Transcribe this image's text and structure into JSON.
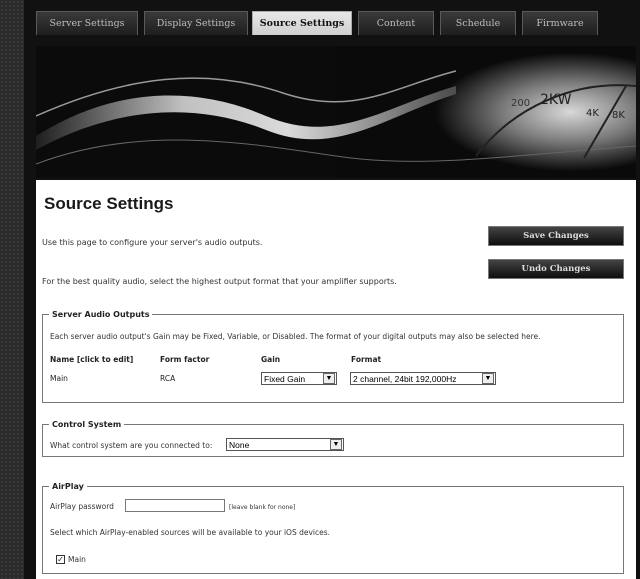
{
  "tabs": [
    {
      "label": "Server Settings",
      "active": false
    },
    {
      "label": "Display Settings",
      "active": false
    },
    {
      "label": "Source Settings",
      "active": true
    },
    {
      "label": "Content",
      "active": false
    },
    {
      "label": "Schedule",
      "active": false
    },
    {
      "label": "Firmware",
      "active": false
    }
  ],
  "banner": {
    "meter_labels": [
      "200",
      "2KW",
      "4K",
      "8K"
    ]
  },
  "page": {
    "title": "Source Settings",
    "intro_1": "Use this page to configure your server's audio outputs.",
    "intro_2": "For the best quality audio, select the highest output format that your amplifier supports."
  },
  "buttons": {
    "save": "Save Changes",
    "undo": "Undo Changes"
  },
  "audio_outputs": {
    "legend": "Server Audio Outputs",
    "description": "Each server audio output's Gain may be Fixed, Variable, or Disabled. The format of your digital outputs may also be selected here.",
    "headers": {
      "name": "Name [click to edit]",
      "form_factor": "Form factor",
      "gain": "Gain",
      "format": "Format"
    },
    "rows": [
      {
        "name": "Main",
        "form_factor": "RCA",
        "gain": "Fixed Gain",
        "format": "2 channel, 24bit 192,000Hz"
      }
    ]
  },
  "control_system": {
    "legend": "Control System",
    "question": "What control system are you connected to:",
    "selected": "None"
  },
  "airplay": {
    "legend": "AirPlay",
    "password_label": "AirPlay password",
    "password_value": "",
    "password_hint": "[leave blank for none]",
    "sources_prompt": "Select which AirPlay-enabled sources will be available to your iOS devices.",
    "sources": [
      {
        "label": "Main",
        "checked": true
      }
    ]
  },
  "icons": {
    "dropdown": "chevron-down-icon",
    "check": "check-icon"
  }
}
